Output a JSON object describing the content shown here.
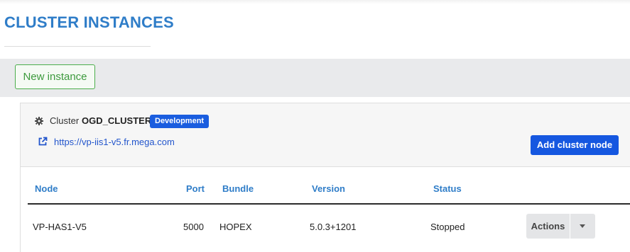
{
  "page": {
    "title": "CLUSTER INSTANCES"
  },
  "toolbar": {
    "new_instance_label": "New instance"
  },
  "cluster": {
    "label": "Cluster",
    "name": "OGD_CLUSTER",
    "environment_badge": "Development",
    "url": "https://vp-iis1-v5.fr.mega.com",
    "add_node_label": "Add cluster node",
    "icons": {
      "cluster": "gear-icon",
      "link": "external-link-icon"
    }
  },
  "table": {
    "columns": [
      "Node",
      "Port",
      "Bundle",
      "Version",
      "Status"
    ],
    "rows": [
      {
        "node": "VP-HAS1-V5",
        "port": "5000",
        "bundle": "HOPEX",
        "version": "5.0.3+1201",
        "status": "Stopped",
        "actions_label": "Actions"
      }
    ]
  },
  "colors": {
    "title": "#2f7dc8",
    "primary_button": "#1557e0",
    "success_outline": "#4cae4c",
    "badge": "#1a5ddf"
  }
}
